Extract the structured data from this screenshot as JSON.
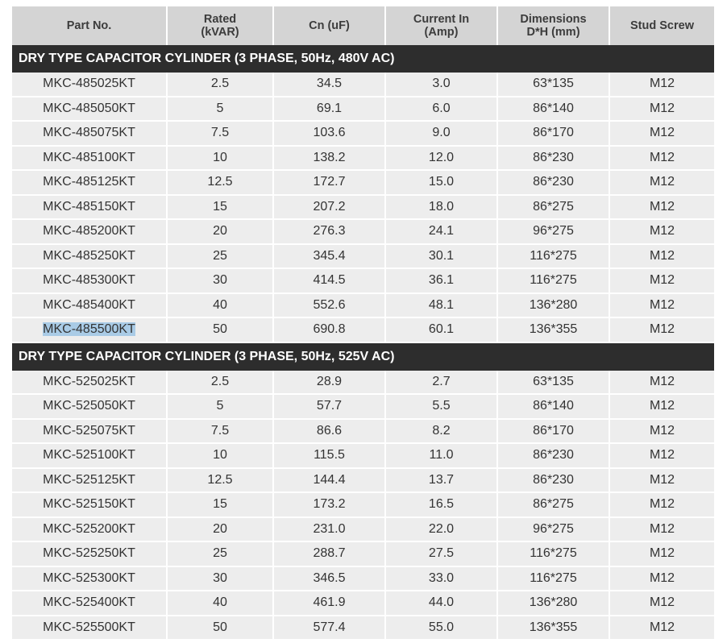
{
  "headers": [
    "Part No.",
    "Rated\n(kVAR)",
    "Cn (uF)",
    "Current In\n(Amp)",
    "Dimensions\nD*H (mm)",
    "Stud Screw"
  ],
  "sections": [
    {
      "title": "DRY TYPE CAPACITOR CYLINDER (3 PHASE, 50Hz, 480V AC)",
      "rows": [
        [
          "MKC-485025KT",
          "2.5",
          "34.5",
          "3.0",
          "63*135",
          "M12"
        ],
        [
          "MKC-485050KT",
          "5",
          "69.1",
          "6.0",
          "86*140",
          "M12"
        ],
        [
          "MKC-485075KT",
          "7.5",
          "103.6",
          "9.0",
          "86*170",
          "M12"
        ],
        [
          "MKC-485100KT",
          "10",
          "138.2",
          "12.0",
          "86*230",
          "M12"
        ],
        [
          "MKC-485125KT",
          "12.5",
          "172.7",
          "15.0",
          "86*230",
          "M12"
        ],
        [
          "MKC-485150KT",
          "15",
          "207.2",
          "18.0",
          "86*275",
          "M12"
        ],
        [
          "MKC-485200KT",
          "20",
          "276.3",
          "24.1",
          "96*275",
          "M12"
        ],
        [
          "MKC-485250KT",
          "25",
          "345.4",
          "30.1",
          "116*275",
          "M12"
        ],
        [
          "MKC-485300KT",
          "30",
          "414.5",
          "36.1",
          "116*275",
          "M12"
        ],
        [
          "MKC-485400KT",
          "40",
          "552.6",
          "48.1",
          "136*280",
          "M12"
        ],
        [
          "MKC-485500KT",
          "50",
          "690.8",
          "60.1",
          "136*355",
          "M12"
        ]
      ]
    },
    {
      "title": "DRY TYPE CAPACITOR CYLINDER (3 PHASE, 50Hz, 525V AC)",
      "rows": [
        [
          "MKC-525025KT",
          "2.5",
          "28.9",
          "2.7",
          "63*135",
          "M12"
        ],
        [
          "MKC-525050KT",
          "5",
          "57.7",
          "5.5",
          "86*140",
          "M12"
        ],
        [
          "MKC-525075KT",
          "7.5",
          "86.6",
          "8.2",
          "86*170",
          "M12"
        ],
        [
          "MKC-525100KT",
          "10",
          "115.5",
          "11.0",
          "86*230",
          "M12"
        ],
        [
          "MKC-525125KT",
          "12.5",
          "144.4",
          "13.7",
          "86*230",
          "M12"
        ],
        [
          "MKC-525150KT",
          "15",
          "173.2",
          "16.5",
          "86*275",
          "M12"
        ],
        [
          "MKC-525200KT",
          "20",
          "231.0",
          "22.0",
          "96*275",
          "M12"
        ],
        [
          "MKC-525250KT",
          "25",
          "288.7",
          "27.5",
          "116*275",
          "M12"
        ],
        [
          "MKC-525300KT",
          "30",
          "346.5",
          "33.0",
          "116*275",
          "M12"
        ],
        [
          "MKC-525400KT",
          "40",
          "461.9",
          "44.0",
          "136*280",
          "M12"
        ],
        [
          "MKC-525500KT",
          "50",
          "577.4",
          "55.0",
          "136*355",
          "M12"
        ]
      ]
    }
  ],
  "highlighted_part": "MKC-485500KT",
  "colors": {
    "header_bg": "#d4d4d4",
    "section_bg": "#2d2d2d",
    "row_bg": "#ededed",
    "selection": "#a9cbe6"
  }
}
